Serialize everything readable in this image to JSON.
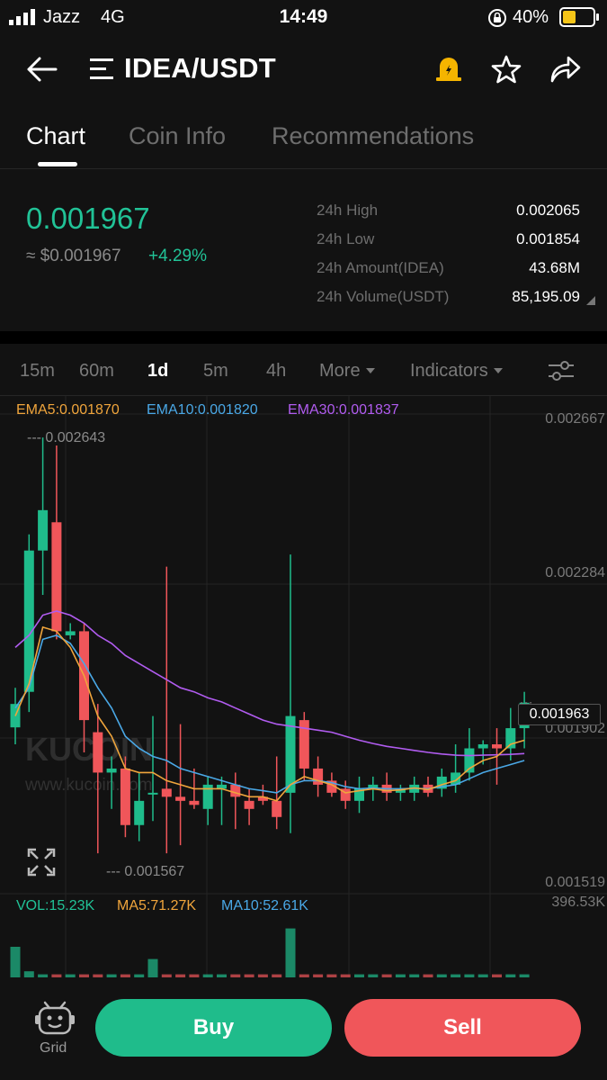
{
  "status_bar": {
    "carrier": "Jazz",
    "network": "4G",
    "time": "14:49",
    "battery": "40%"
  },
  "header": {
    "title": "IDEA/USDT",
    "icons": [
      "back-arrow-icon",
      "menu-lines-icon",
      "alert-bell-icon",
      "star-icon",
      "share-icon"
    ]
  },
  "tabs": [
    {
      "label": "Chart"
    },
    {
      "label": "Coin Info"
    },
    {
      "label": "Recommendations"
    }
  ],
  "ticker": {
    "last_price": "0.001967",
    "usd_price": "≈ $0.001967",
    "change": "+4.29%",
    "stats": [
      {
        "label": "24h High",
        "value": "0.002065"
      },
      {
        "label": "24h Low",
        "value": "0.001854"
      },
      {
        "label": "24h Amount(IDEA)",
        "value": "43.68M"
      },
      {
        "label": "24h Volume(USDT)",
        "value": "85,195.09"
      }
    ]
  },
  "intervals": [
    {
      "label": "15m"
    },
    {
      "label": "60m"
    },
    {
      "label": "1d"
    },
    {
      "label": "5m"
    },
    {
      "label": "4h"
    },
    {
      "label": "More"
    },
    {
      "label": "Indicators"
    }
  ],
  "ema_legend": {
    "ema5": "EMA5:0.001870",
    "ema10": "EMA10:0.001820",
    "ema30": "EMA30:0.001837"
  },
  "price_axis": [
    "0.002667",
    "0.002284",
    "0.001902",
    "0.001519"
  ],
  "current_price_tag": "0.001963",
  "high_marker": "--- 0.002643",
  "low_marker": "--- 0.001567",
  "watermark": {
    "brand": "KUCOIN",
    "url": "www.kucoin.com"
  },
  "vol_legend": {
    "vol": "VOL:15.23K",
    "ma5": "MA5:71.27K",
    "ma10": "MA10:52.61K",
    "max": "396.53K"
  },
  "bottom_bar": {
    "grid_label": "Grid",
    "buy_label": "Buy",
    "sell_label": "Sell"
  },
  "colors": {
    "up": "#1fbc8b",
    "down": "#f0565a",
    "ema5": "#f0a53c",
    "ema10": "#4aa8e6",
    "ema30": "#b15cf0"
  },
  "chart_data": {
    "type": "candlestick",
    "ylim": [
      0.001519,
      0.002667
    ],
    "candles": [
      {
        "o": 0.001902,
        "h": 0.002,
        "l": 0.00186,
        "c": 0.00196
      },
      {
        "o": 0.00199,
        "h": 0.00238,
        "l": 0.00194,
        "c": 0.00234
      },
      {
        "o": 0.00234,
        "h": 0.00262,
        "l": 0.00223,
        "c": 0.00244
      },
      {
        "o": 0.00241,
        "h": 0.0026,
        "l": 0.00212,
        "c": 0.00214
      },
      {
        "o": 0.00213,
        "h": 0.00216,
        "l": 0.00212,
        "c": 0.00214
      },
      {
        "o": 0.00214,
        "h": 0.00216,
        "l": 0.00184,
        "c": 0.00192
      },
      {
        "o": 0.00189,
        "h": 0.00196,
        "l": 0.00159,
        "c": 0.00179
      },
      {
        "o": 0.00179,
        "h": 0.00183,
        "l": 0.0017,
        "c": 0.0018
      },
      {
        "o": 0.0018,
        "h": 0.00183,
        "l": 0.00163,
        "c": 0.00166
      },
      {
        "o": 0.00166,
        "h": 0.00179,
        "l": 0.00162,
        "c": 0.00172
      },
      {
        "o": 0.00174,
        "h": 0.00193,
        "l": 0.00167,
        "c": 0.00174
      },
      {
        "o": 0.00175,
        "h": 0.0023,
        "l": 0.00159,
        "c": 0.00173
      },
      {
        "o": 0.00173,
        "h": 0.00191,
        "l": 0.00161,
        "c": 0.00172
      },
      {
        "o": 0.00172,
        "h": 0.0018,
        "l": 0.0017,
        "c": 0.00171
      },
      {
        "o": 0.0017,
        "h": 0.00178,
        "l": 0.00166,
        "c": 0.00176
      },
      {
        "o": 0.00175,
        "h": 0.00178,
        "l": 0.00166,
        "c": 0.00176
      },
      {
        "o": 0.00176,
        "h": 0.00179,
        "l": 0.00165,
        "c": 0.00173
      },
      {
        "o": 0.00172,
        "h": 0.00175,
        "l": 0.00166,
        "c": 0.0017
      },
      {
        "o": 0.00173,
        "h": 0.00176,
        "l": 0.00171,
        "c": 0.00172
      },
      {
        "o": 0.00172,
        "h": 0.00183,
        "l": 0.00165,
        "c": 0.00168
      },
      {
        "o": 0.00174,
        "h": 0.00233,
        "l": 0.00164,
        "c": 0.00193
      },
      {
        "o": 0.00192,
        "h": 0.00194,
        "l": 0.00177,
        "c": 0.0018
      },
      {
        "o": 0.0018,
        "h": 0.00183,
        "l": 0.00173,
        "c": 0.00176
      },
      {
        "o": 0.00177,
        "h": 0.00179,
        "l": 0.00173,
        "c": 0.00174
      },
      {
        "o": 0.00175,
        "h": 0.00177,
        "l": 0.0017,
        "c": 0.00172
      },
      {
        "o": 0.00172,
        "h": 0.00178,
        "l": 0.00169,
        "c": 0.00175
      },
      {
        "o": 0.00175,
        "h": 0.00178,
        "l": 0.00172,
        "c": 0.00176
      },
      {
        "o": 0.00176,
        "h": 0.00179,
        "l": 0.00172,
        "c": 0.00174
      },
      {
        "o": 0.00174,
        "h": 0.00176,
        "l": 0.00172,
        "c": 0.00175
      },
      {
        "o": 0.00174,
        "h": 0.00178,
        "l": 0.00172,
        "c": 0.00176
      },
      {
        "o": 0.00176,
        "h": 0.00178,
        "l": 0.00173,
        "c": 0.00174
      },
      {
        "o": 0.00175,
        "h": 0.0018,
        "l": 0.00173,
        "c": 0.00178
      },
      {
        "o": 0.00176,
        "h": 0.00186,
        "l": 0.00174,
        "c": 0.00179
      },
      {
        "o": 0.00179,
        "h": 0.0019,
        "l": 0.00177,
        "c": 0.00185
      },
      {
        "o": 0.00185,
        "h": 0.00187,
        "l": 0.00181,
        "c": 0.00186
      },
      {
        "o": 0.00186,
        "h": 0.0019,
        "l": 0.00176,
        "c": 0.00185
      },
      {
        "o": 0.00185,
        "h": 0.00195,
        "l": 0.00182,
        "c": 0.0019
      },
      {
        "o": 0.0019,
        "h": 0.00199,
        "l": 0.00185,
        "c": 0.001963
      }
    ],
    "ema5": [
      0.00193,
      0.00201,
      0.00215,
      0.00214,
      0.0021,
      0.00203,
      0.00193,
      0.00188,
      0.0018,
      0.00179,
      0.00179,
      0.00177,
      0.00176,
      0.00175,
      0.00175,
      0.00175,
      0.00174,
      0.00173,
      0.00173,
      0.00172,
      0.00176,
      0.00178,
      0.00177,
      0.00176,
      0.00174,
      0.001745,
      0.00175,
      0.001745,
      0.001747,
      0.001752,
      0.001748,
      0.00176,
      0.00177,
      0.0018,
      0.00182,
      0.00183,
      0.00186,
      0.00187
    ],
    "ema10": [
      0.00195,
      0.002,
      0.00212,
      0.00213,
      0.00211,
      0.00206,
      0.002,
      0.00195,
      0.00188,
      0.00185,
      0.00183,
      0.00182,
      0.0018,
      0.00179,
      0.00178,
      0.00177,
      0.00176,
      0.00175,
      0.001745,
      0.00174,
      0.00176,
      0.00177,
      0.00177,
      0.001765,
      0.001755,
      0.00175,
      0.001752,
      0.00175,
      0.00175,
      0.001751,
      0.00175,
      0.001755,
      0.00176,
      0.001775,
      0.00179,
      0.0018,
      0.00181,
      0.00182
    ],
    "ema30": [
      0.0021,
      0.00213,
      0.00218,
      0.00219,
      0.00218,
      0.00216,
      0.00213,
      0.00211,
      0.00208,
      0.00206,
      0.00204,
      0.00202,
      0.002,
      0.00199,
      0.001975,
      0.001965,
      0.00195,
      0.001935,
      0.00192,
      0.00191,
      0.001905,
      0.0019,
      0.001895,
      0.00189,
      0.00188,
      0.00187,
      0.001862,
      0.001855,
      0.00185,
      0.001845,
      0.00184,
      0.001836,
      0.001833,
      0.001832,
      0.001833,
      0.001834,
      0.001835,
      0.001837
    ],
    "volume_visible": [
      1,
      0.2,
      0.1,
      0.1,
      0.1,
      0.1,
      0.1,
      0.1,
      0.1,
      0.1,
      0.6,
      0.1,
      0.1,
      0.1,
      0.1,
      0.1,
      0.1,
      0.1,
      0.1,
      0.1,
      1.6,
      0.1,
      0.1,
      0.1,
      0.1,
      0.1,
      0.1,
      0.1,
      0.1,
      0.1,
      0.1,
      0.1,
      0.1,
      0.1,
      0.1,
      0.1,
      0.1,
      0.1
    ]
  }
}
